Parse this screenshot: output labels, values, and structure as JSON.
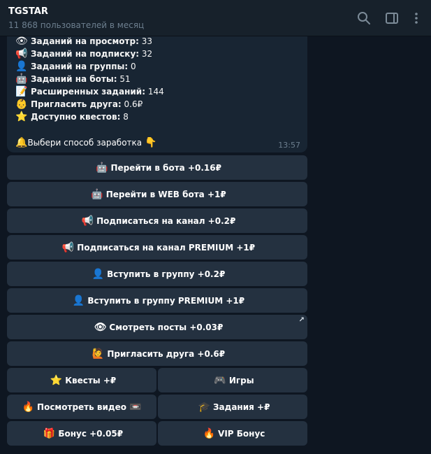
{
  "header": {
    "title": "TGSTAR",
    "subtitle": "11 868 пользователей в месяц",
    "icons": [
      "search-icon",
      "sidebar-toggle-icon",
      "more-vertical-icon"
    ]
  },
  "message": {
    "stats": [
      {
        "emoji": "👁",
        "label": "Заданий на просмотр:",
        "value": "33"
      },
      {
        "emoji": "📢",
        "label": "Заданий на подписку:",
        "value": "32"
      },
      {
        "emoji": "👤",
        "label": "Заданий на группы:",
        "value": "0"
      },
      {
        "emoji": "🤖",
        "label": "Заданий на боты:",
        "value": "51"
      },
      {
        "emoji": "📝",
        "label": "Расширенных заданий:",
        "value": "144"
      },
      {
        "emoji": "👶",
        "label": "Пригласить друга:",
        "value": "0.6₽"
      },
      {
        "emoji": "⭐",
        "label": "Доступно квестов:",
        "value": "8"
      }
    ],
    "prompt_emoji": "🔔",
    "prompt": "Выбери способ заработка",
    "prompt_end_emoji": "👇",
    "time": "13:57"
  },
  "keyboard": {
    "go_bot": {
      "emoji": "🤖",
      "label": "Перейти в бота +0.16₽"
    },
    "go_web_bot": {
      "emoji": "🤖",
      "label": "Перейти в WEB бота +1₽"
    },
    "subscribe": {
      "emoji": "📢",
      "label": "Подписаться на канал +0.2₽"
    },
    "subscribe_premium": {
      "emoji": "📢",
      "label": "Подписаться на канал PREMIUM +1₽"
    },
    "join_group": {
      "emoji": "👤",
      "label": "Вступить в группу +0.2₽"
    },
    "join_group_premium": {
      "emoji": "👤",
      "label": "Вступить в группу PREMIUM +1₽"
    },
    "view_posts": {
      "emoji": "👁",
      "label": "Смотреть посты +0.03₽",
      "link_arrow": "↗"
    },
    "invite_friend": {
      "emoji": "🙋",
      "label": "Пригласить друга +0.6₽"
    },
    "quests": {
      "emoji": "⭐",
      "label": "Квесты +₽"
    },
    "games": {
      "emoji": "🎮",
      "label": "Игры"
    },
    "watch_video": {
      "emoji": "🔥",
      "label": "Посмотреть видео",
      "end_emoji": "📼"
    },
    "tasks": {
      "emoji": "🎓",
      "label": "Задания +₽"
    },
    "bonus": {
      "emoji": "🎁",
      "label": "Бонус +0.05₽"
    },
    "vip_bonus": {
      "emoji": "🔥",
      "label": "VIP Бонус"
    }
  }
}
